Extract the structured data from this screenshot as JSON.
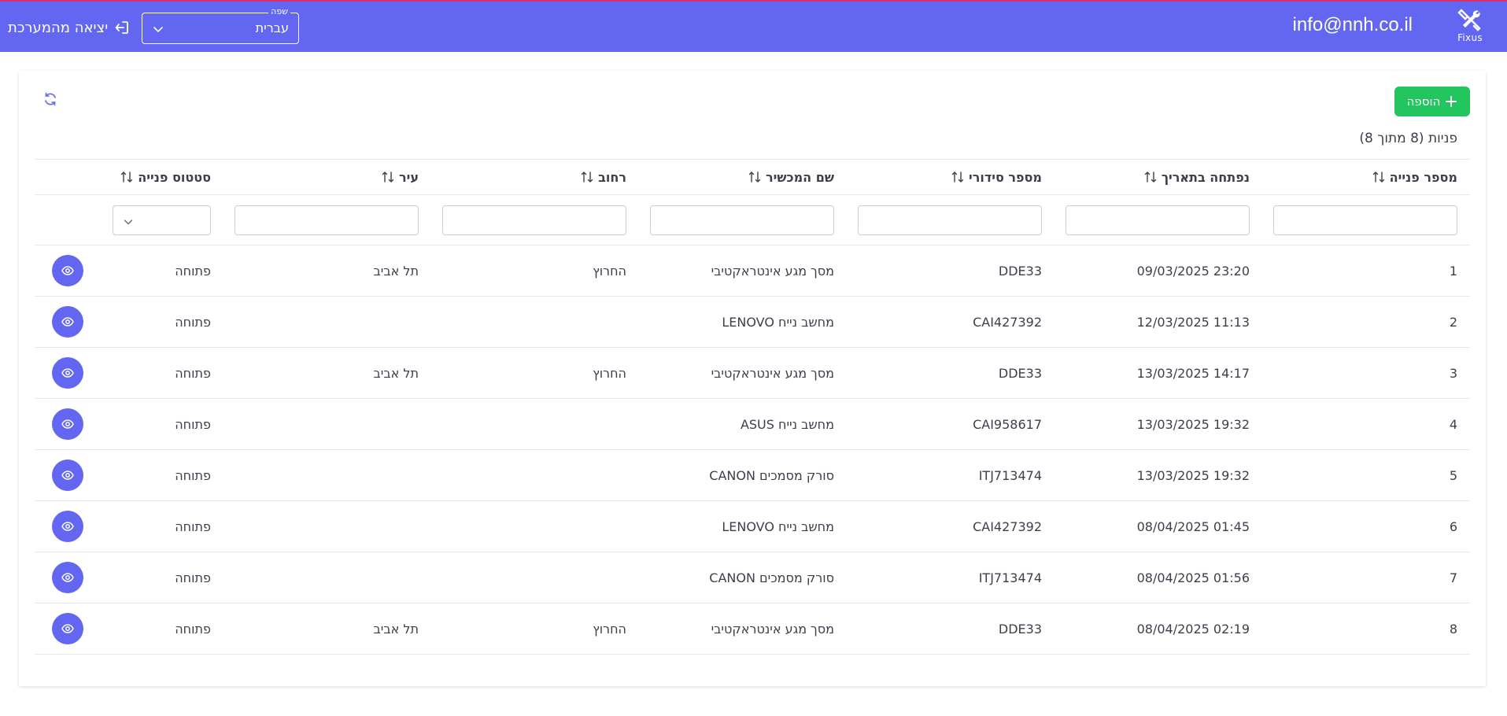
{
  "header": {
    "logo_text": "Fixus",
    "email": "info@nnh.co.il",
    "language_legend": "שפה",
    "language_value": "עברית",
    "logout_label": "יציאה מהמערכת",
    "bg_color": "#6366f1"
  },
  "toolbar": {
    "add_label": "הוספה",
    "refresh_icon": "refresh-icon"
  },
  "summary": "פניות (8 מתוך 8)",
  "table": {
    "columns": [
      "מספר פנייה",
      "נפתחה בתאריך",
      "מספר סידורי",
      "שם המכשיר",
      "רחוב",
      "עיר",
      "סטטוס פנייה"
    ],
    "rows": [
      {
        "id": "1",
        "date": "09/03/2025 23:20",
        "serial": "DDE33",
        "device": "מסך מגע אינטראקטיבי",
        "street": "החרוץ",
        "city": "תל אביב",
        "status": "פתוחה"
      },
      {
        "id": "2",
        "date": "12/03/2025 11:13",
        "serial": "CAI427392",
        "device": "מחשב נייח LENOVO",
        "street": "",
        "city": "",
        "status": "פתוחה"
      },
      {
        "id": "3",
        "date": "13/03/2025 14:17",
        "serial": "DDE33",
        "device": "מסך מגע אינטראקטיבי",
        "street": "החרוץ",
        "city": "תל אביב",
        "status": "פתוחה"
      },
      {
        "id": "4",
        "date": "13/03/2025 19:32",
        "serial": "CAI958617",
        "device": "מחשב נייח ASUS",
        "street": "",
        "city": "",
        "status": "פתוחה"
      },
      {
        "id": "5",
        "date": "13/03/2025 19:32",
        "serial": "ITJ713474",
        "device": "סורק מסמכים CANON",
        "street": "",
        "city": "",
        "status": "פתוחה"
      },
      {
        "id": "6",
        "date": "08/04/2025 01:45",
        "serial": "CAI427392",
        "device": "מחשב נייח LENOVO",
        "street": "",
        "city": "",
        "status": "פתוחה"
      },
      {
        "id": "7",
        "date": "08/04/2025 01:56",
        "serial": "ITJ713474",
        "device": "סורק מסמכים CANON",
        "street": "",
        "city": "",
        "status": "פתוחה"
      },
      {
        "id": "8",
        "date": "08/04/2025 02:19",
        "serial": "DDE33",
        "device": "מסך מגע אינטראקטיבי",
        "street": "החרוץ",
        "city": "תל אביב",
        "status": "פתוחה"
      }
    ]
  },
  "colors": {
    "primary": "#6366f1",
    "success": "#22c55e",
    "border": "#e5e7eb"
  }
}
